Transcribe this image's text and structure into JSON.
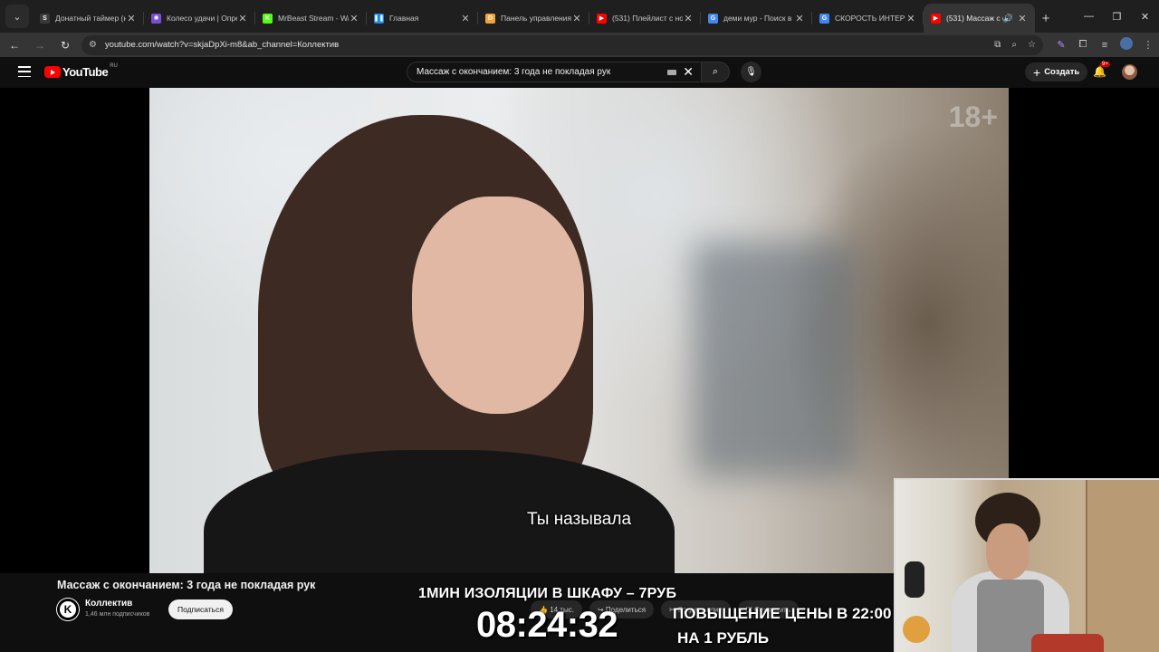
{
  "browser": {
    "tabs": [
      {
        "title": "Донатный таймер (н",
        "favicon": "S",
        "color": "#3a3a3a"
      },
      {
        "title": "Колесо удачи | Опре",
        "favicon": "✺",
        "color": "#7a4fd3"
      },
      {
        "title": "MrBeast Stream - Wa",
        "favicon": "K",
        "color": "#53fc18"
      },
      {
        "title": "Главная",
        "favicon": "❚❚",
        "color": "#1e88e5"
      },
      {
        "title": "Панель управления",
        "favicon": "D",
        "color": "#f2a33a"
      },
      {
        "title": "(531) Плейлист с но",
        "favicon": "▶",
        "color": "#ff0000"
      },
      {
        "title": "деми мур - Поиск в",
        "favicon": "G",
        "color": "#4285f4"
      },
      {
        "title": "СКОРОСТЬ ИНТЕРН",
        "favicon": "G",
        "color": "#4285f4"
      },
      {
        "title": "(531) Массаж с о",
        "favicon": "▶",
        "color": "#ff0000",
        "active": true
      }
    ],
    "url": "youtube.com/watch?v=skjaDpXi-m8&ab_channel=Коллектив"
  },
  "youtube": {
    "logo_text": "YouTube",
    "region": "RU",
    "search_value": "Массаж с окончанием: 3 года не покладая рук",
    "create_label": "Создать",
    "notif_badge": "9+"
  },
  "video": {
    "age_badge": "18+",
    "subtitle": "Ты называла",
    "title": "Массаж с окончанием: 3 года не покладая рук",
    "channel": "Коллектив",
    "channel_initial": "K",
    "subscribers": "1,46 млн подписчиков",
    "subscribe_label": "Подписаться",
    "likes": "14 тыс.",
    "share_label": "Поделиться",
    "clip_label": "Создать клип",
    "save_label": "Сохранить"
  },
  "overlay": {
    "promo": "1МИН ИЗОЛЯЦИИ В ШКАФУ – 7РУБ",
    "timer": "08:24:32",
    "price_line1": "ПОВЫЩЕНИЕ ЦЕНЫ В 22:00",
    "price_line2": "НА 1 РУБЛЬ"
  }
}
